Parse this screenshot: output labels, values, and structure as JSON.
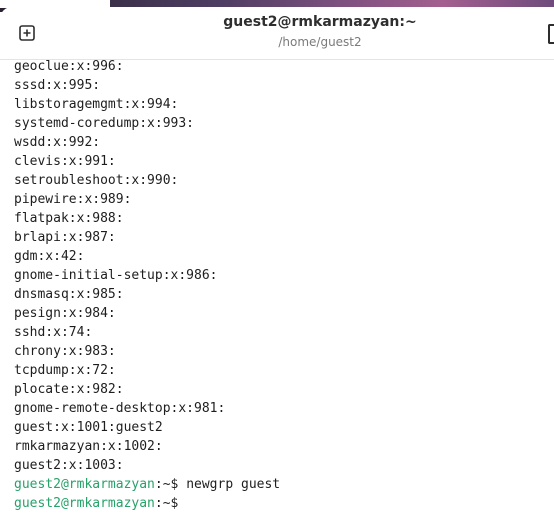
{
  "window": {
    "title": "guest2@rmkarmazyan:~",
    "subtitle": "/home/guest2"
  },
  "icons": {
    "new_tab": "new-tab-plus-icon"
  },
  "colors": {
    "prompt_user": "#26a269",
    "text": "#1e1e1e"
  },
  "terminal": {
    "output_lines": [
      "geoclue:x:996:",
      "sssd:x:995:",
      "libstoragemgmt:x:994:",
      "systemd-coredump:x:993:",
      "wsdd:x:992:",
      "clevis:x:991:",
      "setroubleshoot:x:990:",
      "pipewire:x:989:",
      "flatpak:x:988:",
      "brlapi:x:987:",
      "gdm:x:42:",
      "gnome-initial-setup:x:986:",
      "dnsmasq:x:985:",
      "pesign:x:984:",
      "sshd:x:74:",
      "chrony:x:983:",
      "tcpdump:x:72:",
      "plocate:x:982:",
      "gnome-remote-desktop:x:981:",
      "guest:x:1001:guest2",
      "rmkarmazyan:x:1002:",
      "guest2:x:1003:"
    ],
    "prompts": [
      {
        "user_host": "guest2@rmkarmazyan",
        "path_symbol": ":~$ ",
        "command": "newgrp guest"
      },
      {
        "user_host": "guest2@rmkarmazyan",
        "path_symbol": ":~$ ",
        "command": ""
      }
    ]
  }
}
